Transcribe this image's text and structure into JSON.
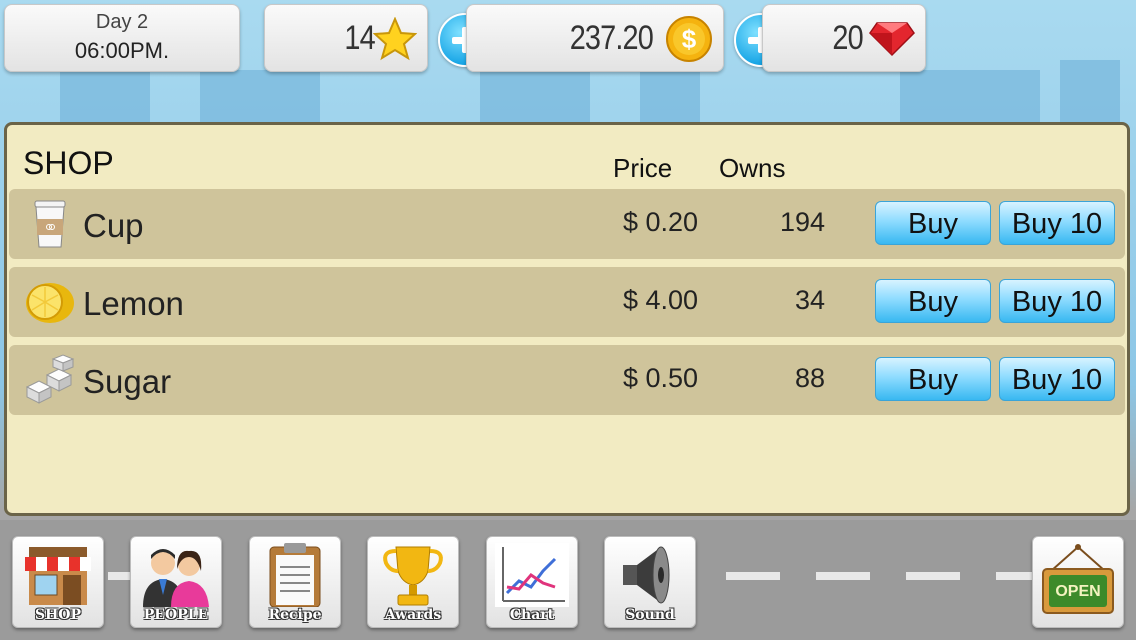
{
  "hud": {
    "day": "Day 2",
    "time": "06:00PM.",
    "stars": "14",
    "money": "237.20",
    "gems": "20"
  },
  "shop": {
    "title": "SHOP",
    "price_header": "Price",
    "owns_header": "Owns",
    "items": [
      {
        "name": "Cup",
        "price": "$ 0.20",
        "owns": "194",
        "buy": "Buy",
        "buy10": "Buy 10",
        "icon": "cup-icon"
      },
      {
        "name": "Lemon",
        "price": "$ 4.00",
        "owns": "34",
        "buy": "Buy",
        "buy10": "Buy 10",
        "icon": "lemon-icon"
      },
      {
        "name": "Sugar",
        "price": "$ 0.50",
        "owns": "88",
        "buy": "Buy",
        "buy10": "Buy 10",
        "icon": "sugar-icon"
      }
    ]
  },
  "toolbar": {
    "shop": "SHOP",
    "people": "PEOPLE",
    "recipe": "Recipe",
    "awards": "Awards",
    "chart": "Chart",
    "sound": "Sound",
    "open": "OPEN"
  },
  "colors": {
    "button_blue": "#38b8f1",
    "panel_bg": "#f2ebc2",
    "row_bg": "#cfc49b"
  }
}
